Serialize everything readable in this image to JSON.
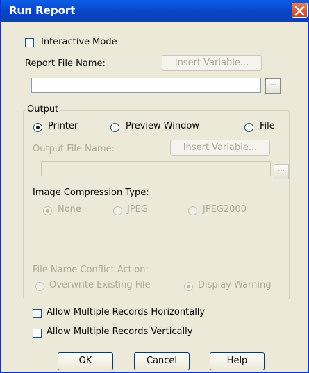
{
  "window": {
    "title": "Run Report"
  },
  "interactive_mode": {
    "label": "Interactive Mode",
    "checked": false
  },
  "report_file": {
    "label": "Report File Name:",
    "insert_variable": "Insert Variable...",
    "value": "",
    "browse": "..."
  },
  "output": {
    "legend": "Output",
    "printer": "Printer",
    "preview_window": "Preview Window",
    "file": "File",
    "selected": "Printer",
    "output_file_label": "Output File Name:",
    "insert_variable": "Insert Variable...",
    "browse": "...",
    "image_compression_label": "Image Compression Type:",
    "compression_none": "None",
    "compression_jpeg": "JPEG",
    "compression_jpeg2000": "JPEG2000",
    "conflict_label": "File Name Conflict Action:",
    "overwrite": "Overwrite Existing File",
    "display_warning": "Display Warning"
  },
  "options": {
    "horizontal": "Allow Multiple Records Horizontally",
    "vertical": "Allow Multiple Records Vertically"
  },
  "buttons": {
    "ok": "OK",
    "cancel": "Cancel",
    "help": "Help"
  }
}
